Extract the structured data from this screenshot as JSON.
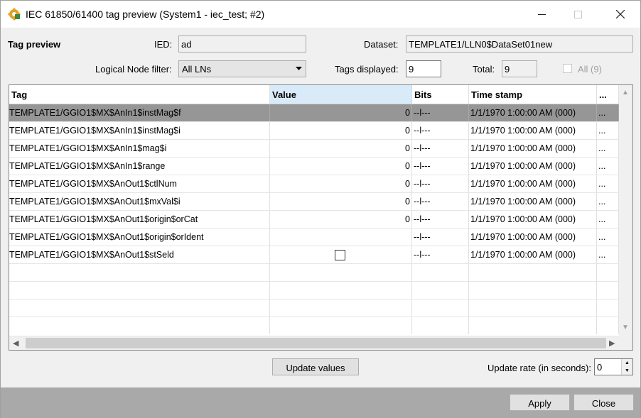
{
  "window": {
    "title": "IEC 61850/61400 tag preview (System1 - iec_test; #2)"
  },
  "header": {
    "section_label": "Tag preview",
    "ied_label": "IED:",
    "ied_value": "ad",
    "dataset_label": "Dataset:",
    "dataset_value": "TEMPLATE1/LLN0$DataSet01new",
    "ln_filter_label": "Logical Node filter:",
    "ln_filter_value": "All LNs",
    "tags_displayed_label": "Tags displayed:",
    "tags_displayed_value": "9",
    "total_label": "Total:",
    "total_value": "9",
    "all_checkbox_label": "All (9)"
  },
  "grid": {
    "columns": [
      "Tag",
      "Value",
      "Bits",
      "Time stamp",
      "..."
    ],
    "rows": [
      {
        "tag": "TEMPLATE1/GGIO1$MX$AnIn1$instMag$f",
        "value": "0",
        "bits": "--l---",
        "timestamp": "1/1/1970 1:00:00 AM  (000)",
        "more": "..."
      },
      {
        "tag": "TEMPLATE1/GGIO1$MX$AnIn1$instMag$i",
        "value": "0",
        "bits": "--l---",
        "timestamp": "1/1/1970 1:00:00 AM  (000)",
        "more": "..."
      },
      {
        "tag": "TEMPLATE1/GGIO1$MX$AnIn1$mag$i",
        "value": "0",
        "bits": "--l---",
        "timestamp": "1/1/1970 1:00:00 AM  (000)",
        "more": "..."
      },
      {
        "tag": "TEMPLATE1/GGIO1$MX$AnIn1$range",
        "value": "0",
        "bits": "--l---",
        "timestamp": "1/1/1970 1:00:00 AM  (000)",
        "more": "..."
      },
      {
        "tag": "TEMPLATE1/GGIO1$MX$AnOut1$ctlNum",
        "value": "0",
        "bits": "--l---",
        "timestamp": "1/1/1970 1:00:00 AM  (000)",
        "more": "..."
      },
      {
        "tag": "TEMPLATE1/GGIO1$MX$AnOut1$mxVal$i",
        "value": "0",
        "bits": "--l---",
        "timestamp": "1/1/1970 1:00:00 AM  (000)",
        "more": "..."
      },
      {
        "tag": "TEMPLATE1/GGIO1$MX$AnOut1$origin$orCat",
        "value": "0",
        "bits": "--l---",
        "timestamp": "1/1/1970 1:00:00 AM  (000)",
        "more": "..."
      },
      {
        "tag": "TEMPLATE1/GGIO1$MX$AnOut1$origin$orIdent",
        "value": "",
        "bits": "--l---",
        "timestamp": "1/1/1970 1:00:00 AM  (000)",
        "more": "..."
      },
      {
        "tag": "TEMPLATE1/GGIO1$MX$AnOut1$stSeld",
        "value": "",
        "bits": "--l---",
        "timestamp": "1/1/1970 1:00:00 AM  (000)",
        "more": "..."
      }
    ]
  },
  "controls": {
    "update_values_label": "Update values",
    "update_rate_label": "Update rate (in seconds):",
    "update_rate_value": "0"
  },
  "footer": {
    "apply_label": "Apply",
    "close_label": "Close"
  },
  "icons": {
    "app": "gear-icon",
    "minimize": "minimize-icon",
    "maximize": "maximize-icon",
    "close": "close-icon",
    "dropdown": "chevron-down-icon"
  }
}
